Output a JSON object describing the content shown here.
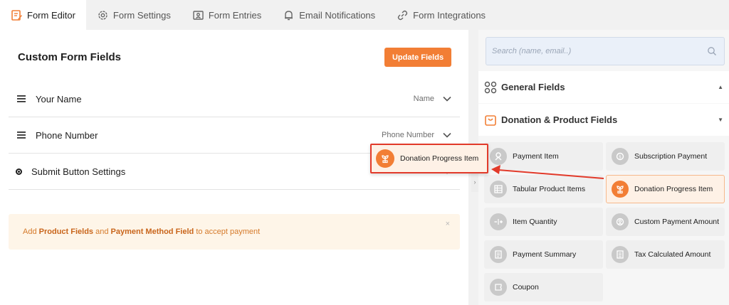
{
  "tabs": [
    {
      "label": "Form Editor",
      "icon": "edit-form-icon",
      "active": true
    },
    {
      "label": "Form Settings",
      "icon": "gear-icon",
      "active": false
    },
    {
      "label": "Form Entries",
      "icon": "user-card-icon",
      "active": false
    },
    {
      "label": "Email Notifications",
      "icon": "bell-icon",
      "active": false
    },
    {
      "label": "Form Integrations",
      "icon": "link-icon",
      "active": false
    }
  ],
  "left": {
    "title": "Custom Form Fields",
    "update_button": "Update Fields",
    "fields": [
      {
        "label": "Your Name",
        "type": "Name"
      },
      {
        "label": "Phone Number",
        "type": "Phone Number"
      },
      {
        "label": "Submit Button Settings",
        "type": "Button"
      }
    ],
    "notice": {
      "prefix": "Add ",
      "product": "Product Fields",
      "middle": " and ",
      "payment": "Payment Method Field",
      "suffix": " to accept payment",
      "close": "×"
    }
  },
  "drag_item": {
    "label": "Donation Progress Item",
    "icon": "seedling-icon"
  },
  "right": {
    "search_placeholder": "Search (name, email..)",
    "sections": [
      {
        "title": "General Fields",
        "icon": "grid-icon",
        "caret": "▲"
      },
      {
        "title": "Donation & Product Fields",
        "icon": "shopping-bag-icon",
        "caret": "▼"
      }
    ],
    "items": [
      {
        "label": "Payment Item",
        "icon": "payment-item-icon"
      },
      {
        "label": "Subscription Payment",
        "icon": "subscription-icon"
      },
      {
        "label": "Tabular Product Items",
        "icon": "table-icon"
      },
      {
        "label": "Donation Progress Item",
        "icon": "seedling-icon",
        "highlight": true
      },
      {
        "label": "Item Quantity",
        "icon": "quantity-icon"
      },
      {
        "label": "Custom Payment Amount",
        "icon": "custom-amount-icon"
      },
      {
        "label": "Payment Summary",
        "icon": "summary-icon"
      },
      {
        "label": "Tax Calculated Amount",
        "icon": "tax-icon"
      },
      {
        "label": "Coupon",
        "icon": "coupon-icon"
      }
    ]
  },
  "colors": {
    "accent": "#f27e35",
    "arrow": "#e23a2a",
    "notice_bg": "#fef5e8"
  }
}
